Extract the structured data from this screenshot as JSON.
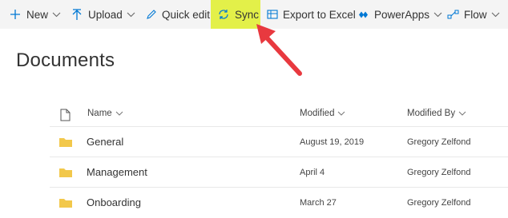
{
  "toolbar": {
    "new_label": "New",
    "upload_label": "Upload",
    "quick_edit_label": "Quick edit",
    "sync_label": "Sync",
    "export_label": "Export to Excel",
    "powerapps_label": "PowerApps",
    "flow_label": "Flow",
    "highlight_color": "#e3f049"
  },
  "page": {
    "title": "Documents"
  },
  "columns": {
    "name": "Name",
    "modified": "Modified",
    "modified_by": "Modified By"
  },
  "rows": [
    {
      "name": "General",
      "modified": "August 19, 2019",
      "modified_by": "Gregory Zelfond"
    },
    {
      "name": "Management",
      "modified": "April 4",
      "modified_by": "Gregory Zelfond"
    },
    {
      "name": "Onboarding",
      "modified": "March 27",
      "modified_by": "Gregory Zelfond"
    }
  ],
  "colors": {
    "accent": "#0078d4",
    "arrow": "#e8393f",
    "folder": "#f2c84b"
  }
}
